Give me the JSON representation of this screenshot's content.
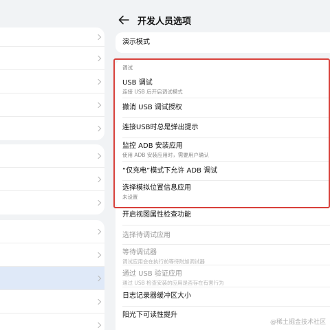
{
  "header": {
    "title": "开发人员选项",
    "back_icon": "arrow-left-icon"
  },
  "demo": {
    "label": "演示模式"
  },
  "debug_section": {
    "label": "调试",
    "items": [
      {
        "title": "USB 调试",
        "subtitle": "连接 USB 后开启调试模式"
      },
      {
        "title": "撤消 USB 调试授权",
        "subtitle": ""
      },
      {
        "title": "连接USB时总是弹出提示",
        "subtitle": ""
      },
      {
        "title": "监控 ADB 安装应用",
        "subtitle": "使用 ADB 安装应用时，需要用户确认"
      },
      {
        "title": "“仅充电”模式下允许 ADB 调试",
        "subtitle": ""
      },
      {
        "title": "选择模拟位置信息应用",
        "subtitle": "未设置"
      }
    ]
  },
  "more_items": [
    {
      "title": "开启视图属性检查功能",
      "subtitle": "",
      "disabled": false
    },
    {
      "title": "选择待调试应用",
      "subtitle": "",
      "disabled": true
    },
    {
      "title": "等待调试器",
      "subtitle": "调试应用会在执行前等待附加调试器",
      "disabled": true
    },
    {
      "title": "通过 USB 验证应用",
      "subtitle": "通过 USB 检查安装的应用是否存在有害行为",
      "disabled": true
    },
    {
      "title": "日志记录器缓冲区大小",
      "subtitle": "",
      "disabled": false
    },
    {
      "title": "阳光下可读性提升",
      "subtitle": "",
      "disabled": false
    }
  ],
  "watermark": "@稀土掘金技术社区",
  "colors": {
    "highlight_border": "#d8403a",
    "selected_row": "#dfe9f8"
  }
}
